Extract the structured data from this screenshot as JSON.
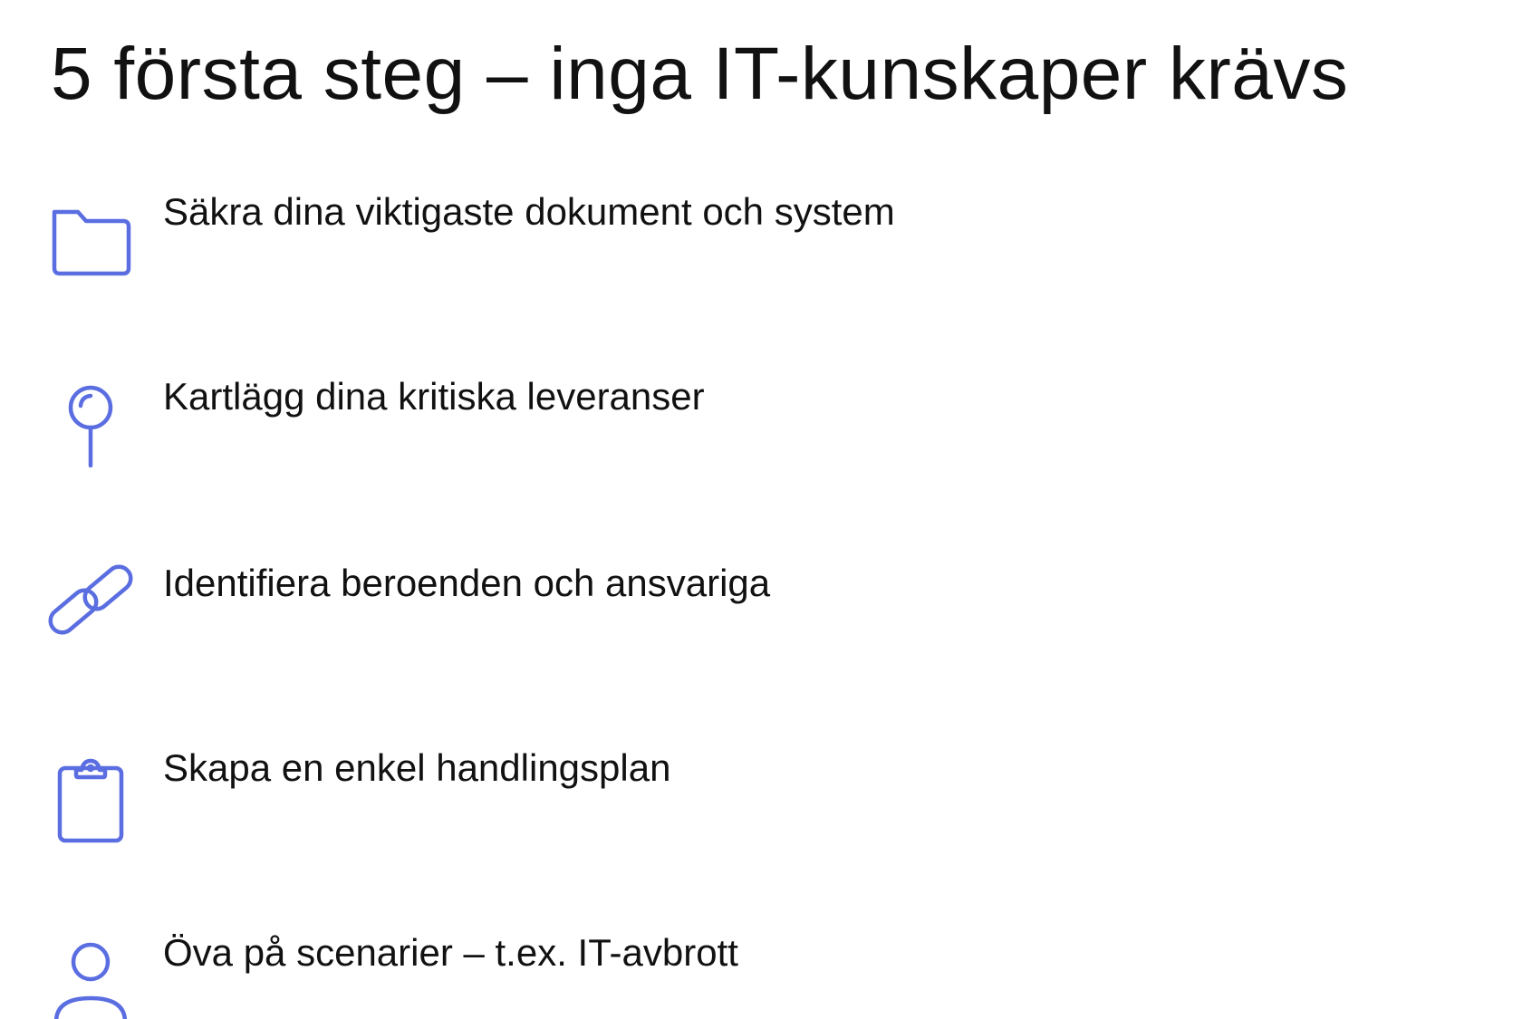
{
  "header": {
    "title": "5 första steg – inga IT-kunskaper krävs"
  },
  "accent_color": "#5b6ee1",
  "steps": [
    {
      "icon": "folder-icon",
      "label": "Säkra dina viktigaste dokument och system"
    },
    {
      "icon": "map-pin-icon",
      "label": "Kartlägg dina kritiska leveranser"
    },
    {
      "icon": "link-icon",
      "label": "Identifiera beroenden och ansvariga"
    },
    {
      "icon": "clipboard-icon",
      "label": "Skapa en enkel handlingsplan"
    },
    {
      "icon": "user-icon",
      "label": "Öva på scenarier – t.ex. IT-avbrott"
    }
  ]
}
